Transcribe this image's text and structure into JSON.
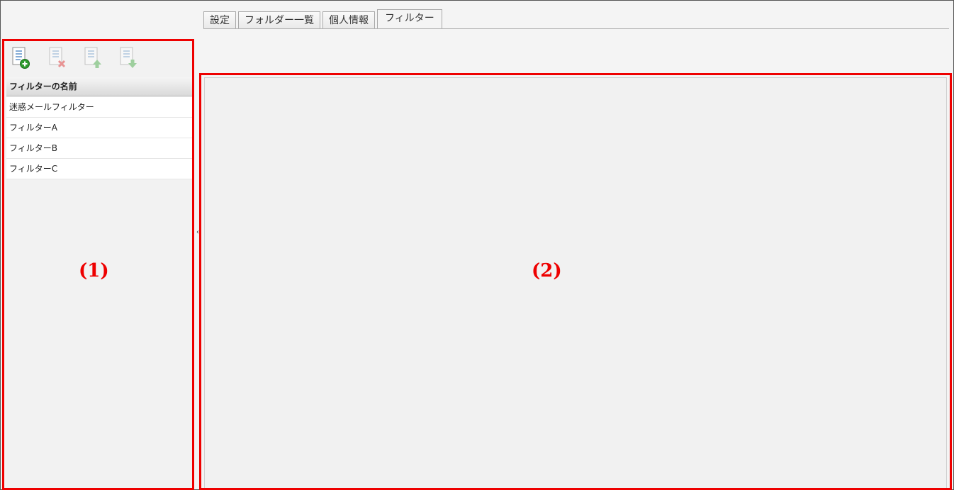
{
  "tabs": [
    {
      "label": "設定",
      "active": false
    },
    {
      "label": "フォルダー一覧",
      "active": false
    },
    {
      "label": "個人情報",
      "active": false
    },
    {
      "label": "フィルター",
      "active": true
    }
  ],
  "toolbar": {
    "buttons": [
      {
        "icon": "add-filter-icon",
        "enabled": true
      },
      {
        "icon": "delete-filter-icon",
        "enabled": false
      },
      {
        "icon": "move-up-icon",
        "enabled": false
      },
      {
        "icon": "move-down-icon",
        "enabled": false
      }
    ]
  },
  "filter_list": {
    "header": "フィルターの名前",
    "items": [
      "迷惑メールフィルター",
      "フィルターA",
      "フィルターB",
      "フィルターC"
    ]
  },
  "annotations": {
    "left_label": "(1)",
    "right_label": "(2)",
    "color": "#ee0000"
  }
}
